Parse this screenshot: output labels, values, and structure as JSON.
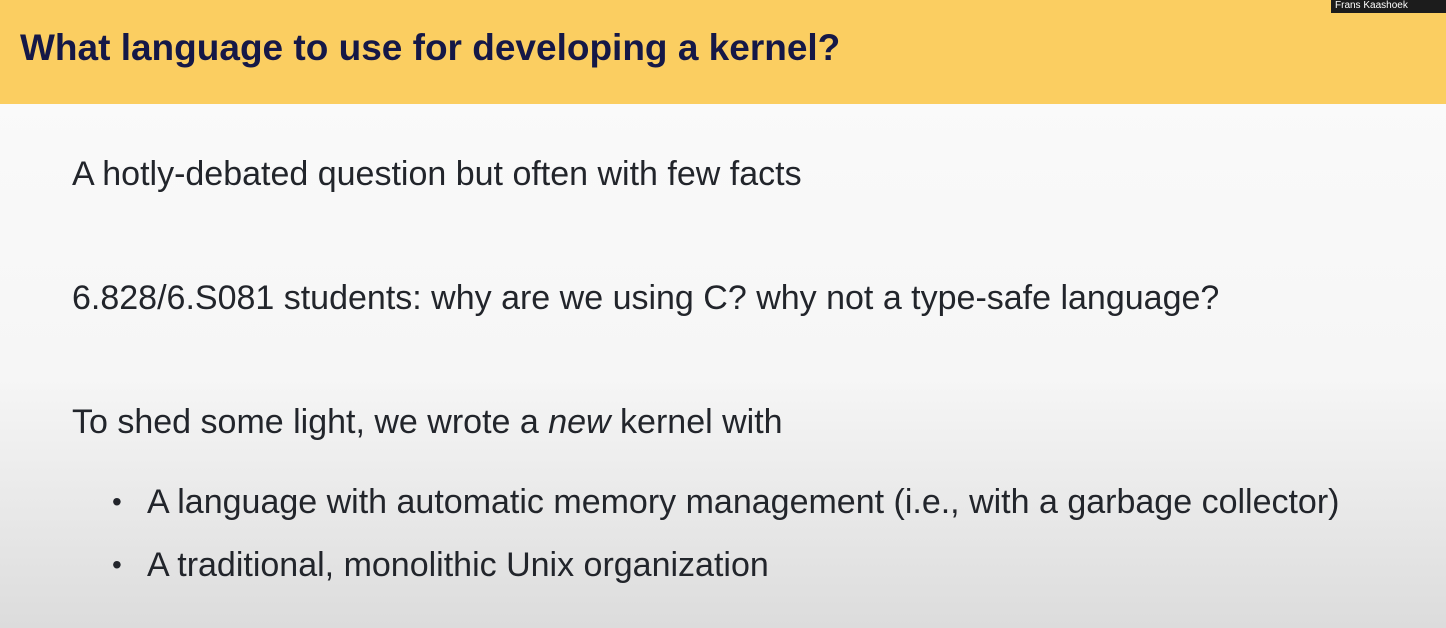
{
  "slide": {
    "title": "What language to use for developing a kernel?",
    "speaker_name": "Frans Kaashoek",
    "paragraphs": {
      "p1": "A hotly-debated question but often with few facts",
      "p2": "6.828/6.S081 students: why are we using C? why not a type-safe language?",
      "p3_before": "To shed some light, we wrote a ",
      "p3_emph": "new",
      "p3_after": " kernel with"
    },
    "bullets": [
      {
        "marker": "•",
        "text": "A language with automatic memory management (i.e., with a garbage collector)"
      },
      {
        "marker": "•",
        "text": "A traditional, monolithic Unix organization"
      }
    ],
    "colors": {
      "header_bg": "#fbce61",
      "title_text": "#151847",
      "body_text": "#22252b"
    }
  }
}
